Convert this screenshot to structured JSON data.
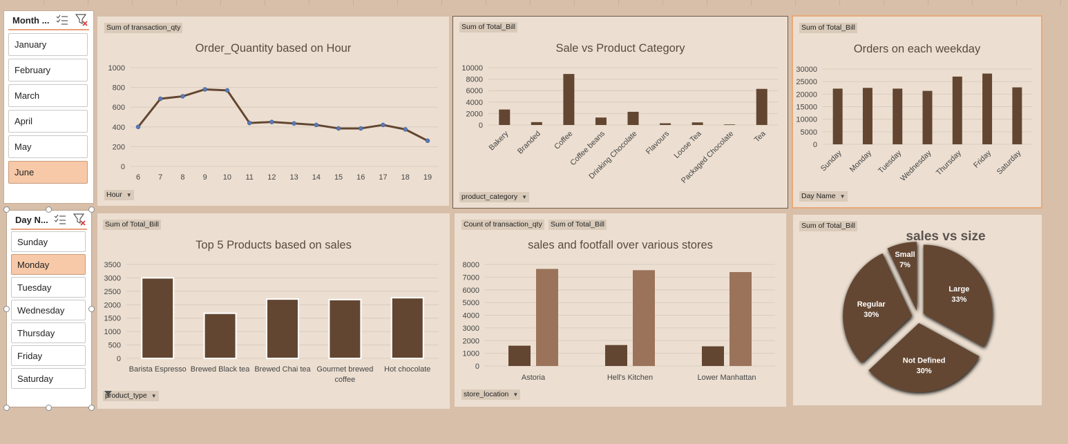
{
  "colors": {
    "bar_dark": "#634631",
    "bar_light": "#9a735a",
    "line": "#634631",
    "marker": "#5a79b7",
    "slicer_selected": "#f7c9a8"
  },
  "month_slicer": {
    "title": "Month ...",
    "items": [
      "January",
      "February",
      "March",
      "April",
      "May",
      "June"
    ],
    "selected": "June"
  },
  "day_slicer": {
    "title": "Day N...",
    "items": [
      "Sunday",
      "Monday",
      "Tuesday",
      "Wednesday",
      "Thursday",
      "Friday",
      "Saturday"
    ],
    "selected": "Monday"
  },
  "chart_data": [
    {
      "id": "hour",
      "type": "line",
      "title": "Order_Quantity based on Hour",
      "value_tag": "Sum of transaction_qty",
      "field_tag": "Hour",
      "x": [
        "6",
        "7",
        "8",
        "9",
        "10",
        "11",
        "12",
        "13",
        "14",
        "15",
        "16",
        "17",
        "18",
        "19"
      ],
      "values": [
        400,
        685,
        710,
        780,
        770,
        440,
        450,
        435,
        420,
        385,
        385,
        420,
        375,
        260
      ],
      "yticks": [
        0,
        200,
        400,
        600,
        800,
        1000
      ],
      "ylim": [
        0,
        1000
      ]
    },
    {
      "id": "category",
      "type": "bar",
      "title": "Sale vs Product Category",
      "value_tag": "Sum of Total_Bill",
      "field_tag": "product_category",
      "categories": [
        "Bakery",
        "Branded",
        "Coffee",
        "Coffee beans",
        "Drinking Chocolate",
        "Flavours",
        "Loose Tea",
        "Packaged Chocolate",
        "Tea"
      ],
      "values": [
        2700,
        500,
        8900,
        1300,
        2300,
        300,
        450,
        100,
        6300
      ],
      "yticks": [
        0,
        2000,
        4000,
        6000,
        8000,
        10000
      ],
      "ylim": [
        0,
        10000
      ]
    },
    {
      "id": "weekday",
      "type": "bar",
      "title": "Orders on each weekday",
      "value_tag": "Sum of Total_Bill",
      "field_tag": "Day Name",
      "categories": [
        "Sunday",
        "Monday",
        "Tuesday",
        "Wednesday",
        "Thursday",
        "Friday",
        "Saturday"
      ],
      "values": [
        22200,
        22500,
        22200,
        21300,
        27000,
        28200,
        22700
      ],
      "yticks": [
        0,
        5000,
        10000,
        15000,
        20000,
        25000,
        30000
      ],
      "ylim": [
        0,
        30000
      ]
    },
    {
      "id": "products",
      "type": "bar",
      "title": "Top 5 Products based on sales",
      "value_tag": "Sum of Total_Bill",
      "field_tag": "product_type",
      "categories": [
        "Barista Espresso",
        "Brewed Black tea",
        "Brewed Chai tea",
        "Gourmet brewed coffee",
        "Hot chocolate"
      ],
      "values": [
        3000,
        1680,
        2210,
        2190,
        2260
      ],
      "yticks": [
        0,
        500,
        1000,
        1500,
        2000,
        2500,
        3000,
        3500
      ],
      "ylim": [
        0,
        3500
      ]
    },
    {
      "id": "stores",
      "type": "bar",
      "title": "sales and footfall over various stores",
      "value_tags": [
        "Count of transaction_qty",
        "Sum of Total_Bill"
      ],
      "field_tag": "store_location",
      "categories": [
        "Astoria",
        "Hell's Kitchen",
        "Lower Manhattan"
      ],
      "series": [
        {
          "values": [
            1600,
            1650,
            1550
          ]
        },
        {
          "values": [
            7650,
            7550,
            7400
          ]
        }
      ],
      "yticks": [
        0,
        1000,
        2000,
        3000,
        4000,
        5000,
        6000,
        7000,
        8000
      ],
      "ylim": [
        0,
        8000
      ]
    },
    {
      "id": "size",
      "type": "pie",
      "title": "sales vs size",
      "value_tag": "Sum of Total_Bill",
      "slices": [
        {
          "label": "Large",
          "percent": "33%",
          "value": 33
        },
        {
          "label": "Not Defined",
          "percent": "30%",
          "value": 30
        },
        {
          "label": "Regular",
          "percent": "30%",
          "value": 30
        },
        {
          "label": "Small",
          "percent": "7%",
          "value": 7
        }
      ]
    }
  ]
}
